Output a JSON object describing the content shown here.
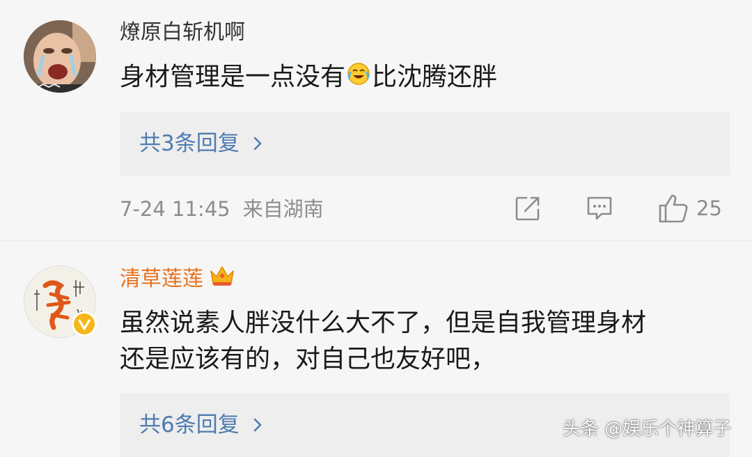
{
  "comments": [
    {
      "username": "燎原白斩机啊",
      "avatar_icon": "crying-child-avatar-icon",
      "text_before_emoji": "身材管理是一点没有",
      "emoji_icon": "laughing-crying-emoji-icon",
      "text_after_emoji": "比沈腾还胖",
      "replies_label": "共3条回复",
      "timestamp": "7-24 11:45",
      "location": "来自湖南",
      "like_count": "25",
      "username_color": "#333333"
    },
    {
      "username": "清草莲莲",
      "avatar_icon": "calligraphy-avatar-icon",
      "badge_icon": "crown-icon",
      "verified_icon": "verified-v-icon",
      "text_line_1": "虽然说素人胖没什么大不了，但是自我管理身材",
      "text_line_2": "还是应该有的，对自己也友好吧，",
      "replies_label": "共6条回复",
      "username_color": "#e8711c"
    }
  ],
  "watermark": "头条 @娱乐个神算子",
  "colors": {
    "background": "#f6f6f6",
    "reply_box": "#eeeeee",
    "link_blue": "#4f7cb0",
    "meta_gray": "#8c8c8c",
    "verified_gold": "#f6b71b"
  }
}
